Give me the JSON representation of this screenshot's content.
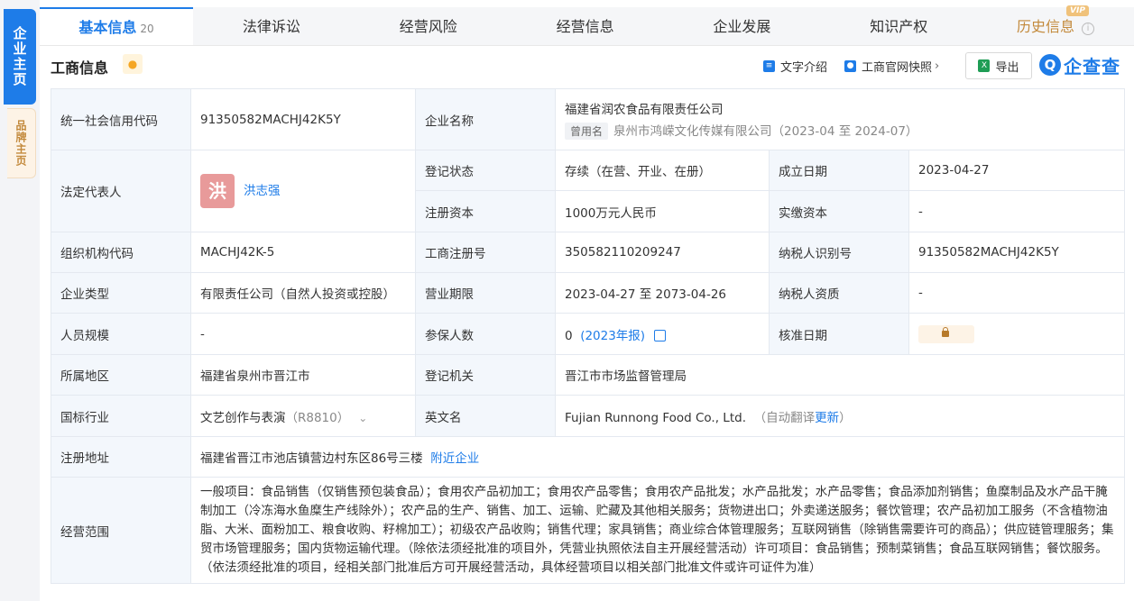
{
  "side": {
    "main_label": "企业主页",
    "brand_label": "品牌主页"
  },
  "tabs": [
    {
      "label": "基本信息",
      "count": "20"
    },
    {
      "label": "法律诉讼"
    },
    {
      "label": "经营风险"
    },
    {
      "label": "经营信息"
    },
    {
      "label": "企业发展"
    },
    {
      "label": "知识产权"
    },
    {
      "label": "历史信息",
      "badge": "VIP"
    }
  ],
  "header": {
    "title": "工商信息",
    "text_intro": "文字介绍",
    "snapshot": "工商官网快照",
    "export": "导出",
    "logo_text": "企查查",
    "logo_mark": "Q"
  },
  "company": {
    "credit_code_label": "统一社会信用代码",
    "credit_code": "91350582MACHJ42K5Y",
    "name_label": "企业名称",
    "name": "福建省润农食品有限责任公司",
    "former_tag": "曾用名",
    "former_name": "泉州市鸿嵘文化传媒有限公司",
    "former_period": "（2023-04 至 2024-07）",
    "legal_rep_label": "法定代表人",
    "legal_rep_avatar": "洪",
    "legal_rep": "洪志强",
    "reg_status_label": "登记状态",
    "reg_status": "存续（在营、开业、在册）",
    "founded_label": "成立日期",
    "founded": "2023-04-27",
    "reg_capital_label": "注册资本",
    "reg_capital": "1000万元人民币",
    "paid_capital_label": "实缴资本",
    "paid_capital": "-",
    "org_code_label": "组织机构代码",
    "org_code": "MACHJ42K-5",
    "biz_reg_no_label": "工商注册号",
    "biz_reg_no": "350582110209247",
    "taxpayer_id_label": "纳税人识别号",
    "taxpayer_id": "91350582MACHJ42K5Y",
    "type_label": "企业类型",
    "type": "有限责任公司（自然人投资或控股）",
    "term_label": "营业期限",
    "term": "2023-04-27 至 2073-04-26",
    "taxpayer_q_label": "纳税人资质",
    "taxpayer_q": "-",
    "staff_label": "人员规模",
    "staff": "-",
    "insured_label": "参保人数",
    "insured": "0",
    "insured_year": "(2023年报)",
    "approve_label": "核准日期",
    "region_label": "所属地区",
    "region": "福建省泉州市晋江市",
    "authority_label": "登记机关",
    "authority": "晋江市市场监督管理局",
    "industry_label": "国标行业",
    "industry": "文艺创作与表演",
    "industry_code": "（R8810）",
    "en_name_label": "英文名",
    "en_name": "Fujian Runnong Food Co., Ltd.",
    "en_note_prefix": "（自动翻译",
    "en_note_link": "更新",
    "en_note_suffix": "）",
    "address_label": "注册地址",
    "address": "福建省晋江市池店镇营边村东区86号三楼",
    "nearby": "附近企业",
    "scope_label": "经营范围",
    "scope": "一般项目：食品销售（仅销售预包装食品）；食用农产品初加工；食用农产品零售；食用农产品批发；水产品批发；水产品零售；食品添加剂销售；鱼糜制品及水产品干腌制加工（冷冻海水鱼糜生产线除外）；农产品的生产、销售、加工、运输、贮藏及其他相关服务；货物进出口；外卖递送服务；餐饮管理；农产品初加工服务（不含植物油脂、大米、面粉加工、粮食收购、籽棉加工）；初级农产品收购；销售代理；家具销售；商业综合体管理服务；互联网销售（除销售需要许可的商品）；供应链管理服务；集贸市场管理服务；国内货物运输代理。（除依法须经批准的项目外，凭营业执照依法自主开展经营活动）许可项目：食品销售；预制菜销售；食品互联网销售；餐饮服务。（依法须经批准的项目，经相关部门批准后方可开展经营活动，具体经营项目以相关部门批准文件或许可证件为准）"
  }
}
